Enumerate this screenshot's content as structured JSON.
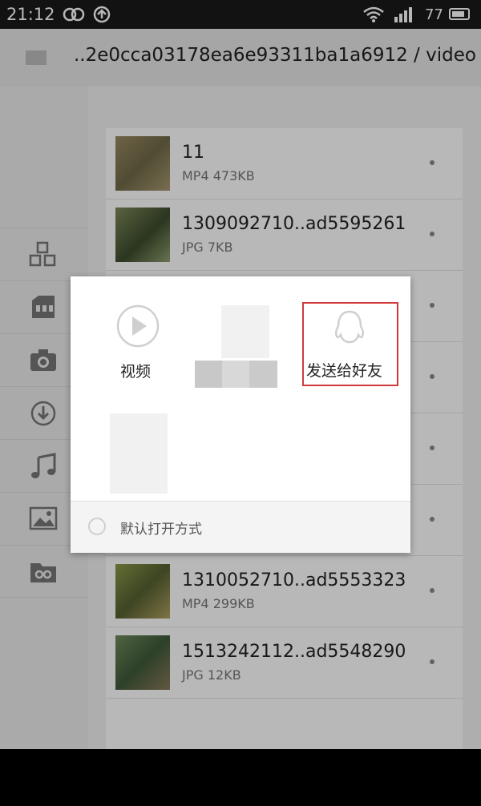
{
  "status_bar": {
    "time": "21:12",
    "battery": "77"
  },
  "app_bar": {
    "path": "..2e0cca03178ea6e93311ba1a6912 / video"
  },
  "sidebar": {
    "icons": [
      "category-icon",
      "sd-card-icon",
      "camera-icon",
      "download-icon",
      "music-icon",
      "image-icon",
      "link-folder-icon"
    ]
  },
  "files": [
    {
      "name": "11",
      "meta": "MP4 473KB",
      "thumb_color": "#8a7a55"
    },
    {
      "name": "1309092710..ad5595261",
      "meta": "JPG 7KB",
      "thumb_color": "#5a6b3c"
    },
    {
      "name": "",
      "meta": "",
      "thumb_color": "#999999"
    },
    {
      "name": "",
      "meta": "",
      "thumb_color": "#999999"
    },
    {
      "name": "",
      "meta": "",
      "thumb_color": "#999999"
    },
    {
      "name": "",
      "meta": "",
      "thumb_color": "#999999"
    },
    {
      "name": "1310052710..ad5553323",
      "meta": "MP4 299KB",
      "thumb_color": "#6e7a3a"
    },
    {
      "name": "1513242112..ad5548290",
      "meta": "JPG 12KB",
      "thumb_color": "#556b4a"
    }
  ],
  "dialog": {
    "options": [
      {
        "label": "视频",
        "icon": "play-video-icon"
      },
      {
        "label": "",
        "icon": "blurred-app-icon"
      },
      {
        "label": "发送给好友",
        "icon": "qq-penguin-icon"
      },
      {
        "label": "",
        "icon": "blurred-app-icon"
      }
    ],
    "highlight_color": "#d23a3a",
    "default_label": "默认打开方式"
  }
}
